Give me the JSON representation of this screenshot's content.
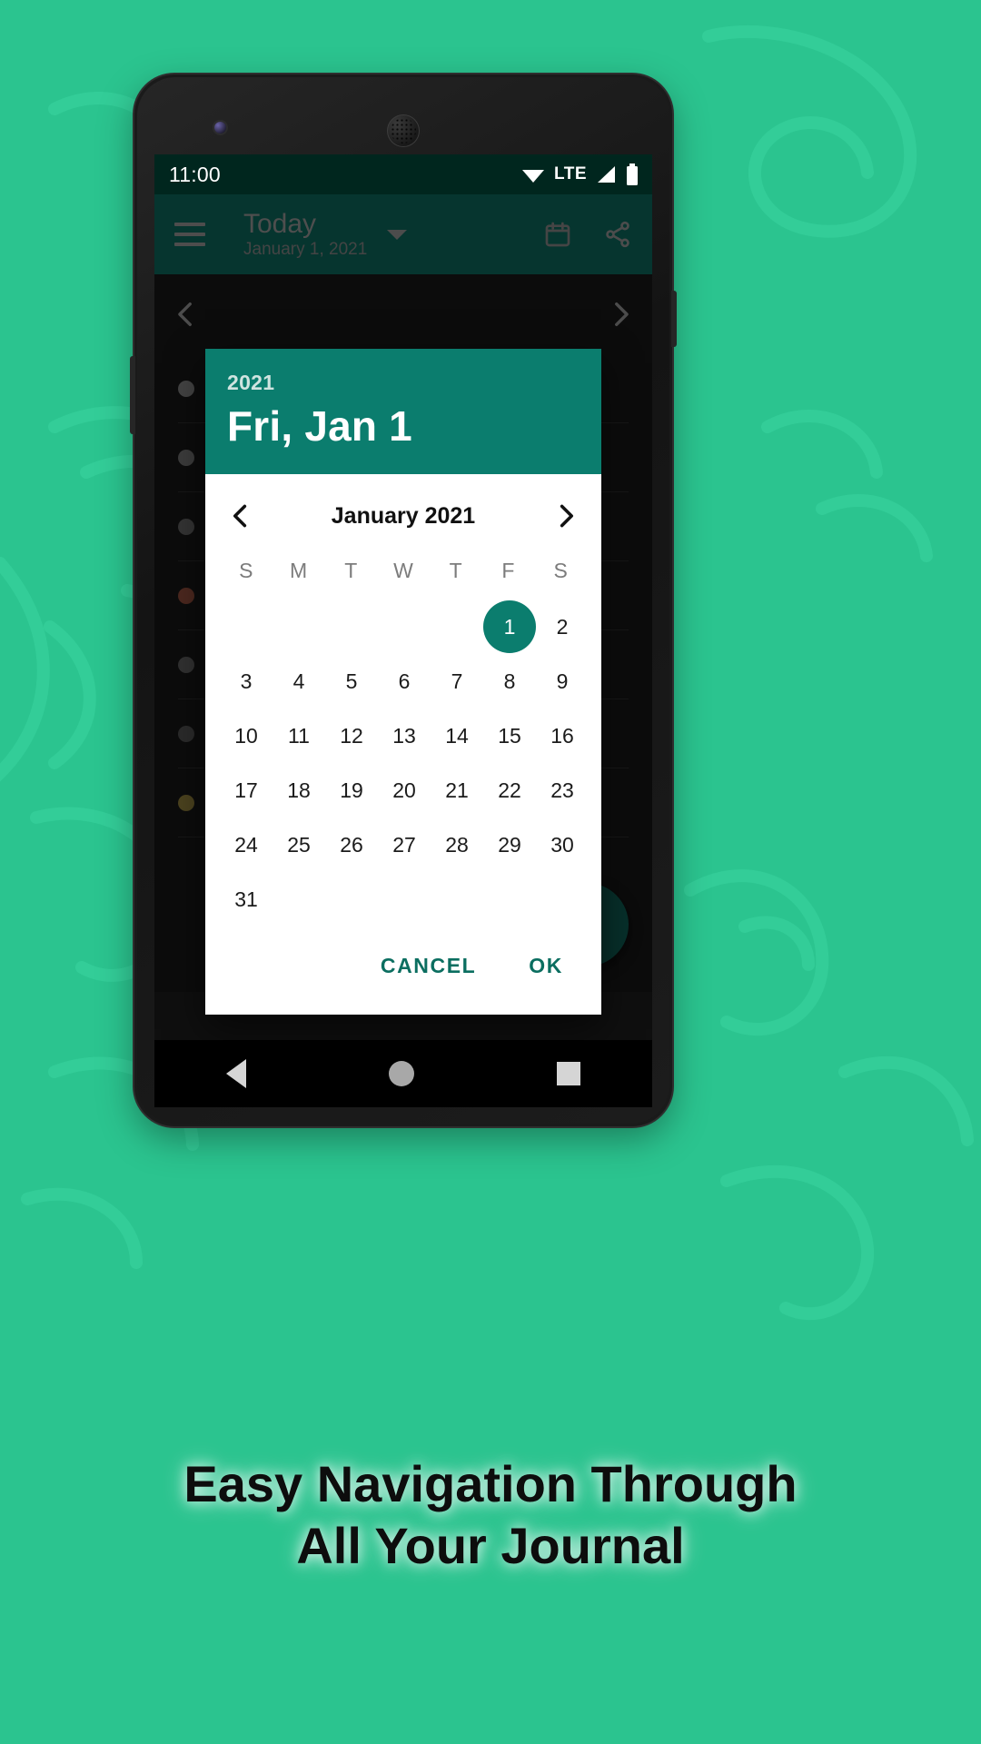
{
  "theme": {
    "background_green": "#2bc48f",
    "accent_teal": "#0b7d6e",
    "app_bar_teal": "#0c6157",
    "status_bar_dark": "#00261e"
  },
  "status_bar": {
    "time": "11:00",
    "icons": [
      "wifi-icon",
      "lte-label",
      "signal-icon",
      "battery-icon"
    ],
    "network_label": "LTE"
  },
  "app_bar": {
    "menu_icon": "hamburger-menu-icon",
    "title": "Today",
    "subtitle": "January 1, 2021",
    "dropdown_icon": "chevron-down-icon",
    "calendar_icon": "calendar-icon",
    "share_icon": "share-icon"
  },
  "pager": {
    "previous_icon": "chevron-left-icon",
    "next_icon": "chevron-right-icon"
  },
  "entries": [
    {
      "color": "#7a7a7a"
    },
    {
      "color": "#6e6e6e"
    },
    {
      "color": "#5f5f5f"
    },
    {
      "color": "#8a4a3a"
    },
    {
      "color": "#5a5a5a"
    },
    {
      "color": "#4f4f4f"
    },
    {
      "color": "#8a7a3a"
    }
  ],
  "fab": {
    "icon": "edit-icon"
  },
  "date_picker": {
    "header": {
      "year": "2021",
      "date": "Fri, Jan 1"
    },
    "month_nav": {
      "previous_icon": "chevron-left-icon",
      "month_label": "January 2021",
      "next_icon": "chevron-right-icon"
    },
    "weekdays": [
      "S",
      "M",
      "T",
      "W",
      "T",
      "F",
      "S"
    ],
    "weeks": [
      [
        "",
        "",
        "",
        "",
        "",
        "1",
        "2"
      ],
      [
        "3",
        "4",
        "5",
        "6",
        "7",
        "8",
        "9"
      ],
      [
        "10",
        "11",
        "12",
        "13",
        "14",
        "15",
        "16"
      ],
      [
        "17",
        "18",
        "19",
        "20",
        "21",
        "22",
        "23"
      ],
      [
        "24",
        "25",
        "26",
        "27",
        "28",
        "29",
        "30"
      ],
      [
        "31",
        "",
        "",
        "",
        "",
        "",
        ""
      ]
    ],
    "selected_day": "1",
    "actions": {
      "cancel_label": "CANCEL",
      "ok_label": "OK"
    }
  },
  "nav_bar": {
    "back_icon": "triangle-back-icon",
    "home_icon": "circle-home-icon",
    "recents_icon": "square-recents-icon"
  },
  "promo": {
    "line1": "Easy Navigation Through",
    "line2": "All Your Journal"
  }
}
